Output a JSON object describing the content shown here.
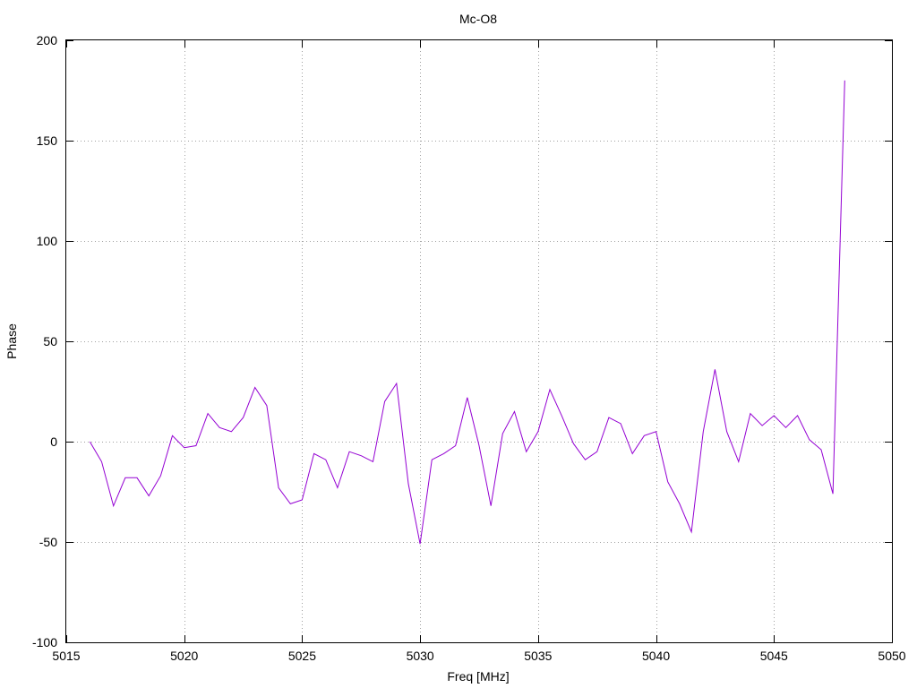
{
  "chart_data": {
    "type": "line",
    "title": "Mc-O8",
    "xlabel": "Freq [MHz]",
    "ylabel": "Phase",
    "xlim": [
      5015,
      5050
    ],
    "ylim": [
      -100,
      200
    ],
    "xticks": [
      5015,
      5020,
      5025,
      5030,
      5035,
      5040,
      5045,
      5050
    ],
    "yticks": [
      -100,
      -50,
      0,
      50,
      100,
      150,
      200
    ],
    "xtick_labels": [
      "5015",
      "5020",
      "5025",
      "5030",
      "5035",
      "5040",
      "5045",
      "5050"
    ],
    "ytick_labels": [
      "-100",
      "-50",
      "0",
      "50",
      "100",
      "150",
      "200"
    ],
    "grid": true,
    "series": [
      {
        "color": "#9400d3",
        "x": [
          5016.0,
          5016.5,
          5017.0,
          5017.5,
          5018.0,
          5018.5,
          5019.0,
          5019.5,
          5020.0,
          5020.5,
          5021.0,
          5021.5,
          5022.0,
          5022.5,
          5023.0,
          5023.5,
          5024.0,
          5024.5,
          5025.0,
          5025.5,
          5026.0,
          5026.5,
          5027.0,
          5027.5,
          5028.0,
          5028.5,
          5029.0,
          5029.5,
          5030.0,
          5030.5,
          5031.0,
          5031.5,
          5032.0,
          5032.5,
          5033.0,
          5033.5,
          5034.0,
          5034.5,
          5035.0,
          5035.5,
          5036.0,
          5036.5,
          5037.0,
          5037.5,
          5038.0,
          5038.5,
          5039.0,
          5039.5,
          5040.0,
          5040.5,
          5041.0,
          5041.5,
          5042.0,
          5042.5,
          5043.0,
          5043.5,
          5044.0,
          5044.5,
          5045.0,
          5045.5,
          5046.0,
          5046.5,
          5047.0,
          5047.5,
          5048.0
        ],
        "y": [
          0,
          -10,
          -32,
          -18,
          -18,
          -27,
          -17,
          3,
          -3,
          -2,
          14,
          7,
          5,
          12,
          27,
          18,
          -23,
          -31,
          -29,
          -6,
          -9,
          -23,
          -5,
          -7,
          -10,
          20,
          29,
          -21,
          -51,
          -9,
          -6,
          -2,
          22,
          -2,
          -32,
          4,
          15,
          -5,
          5,
          26,
          13,
          -1,
          -9,
          -5,
          12,
          9,
          -6,
          3,
          5,
          -20,
          -31,
          -45,
          5,
          36,
          5,
          -10,
          14,
          8,
          13,
          7,
          13,
          1,
          -4,
          -26,
          180
        ]
      }
    ]
  }
}
